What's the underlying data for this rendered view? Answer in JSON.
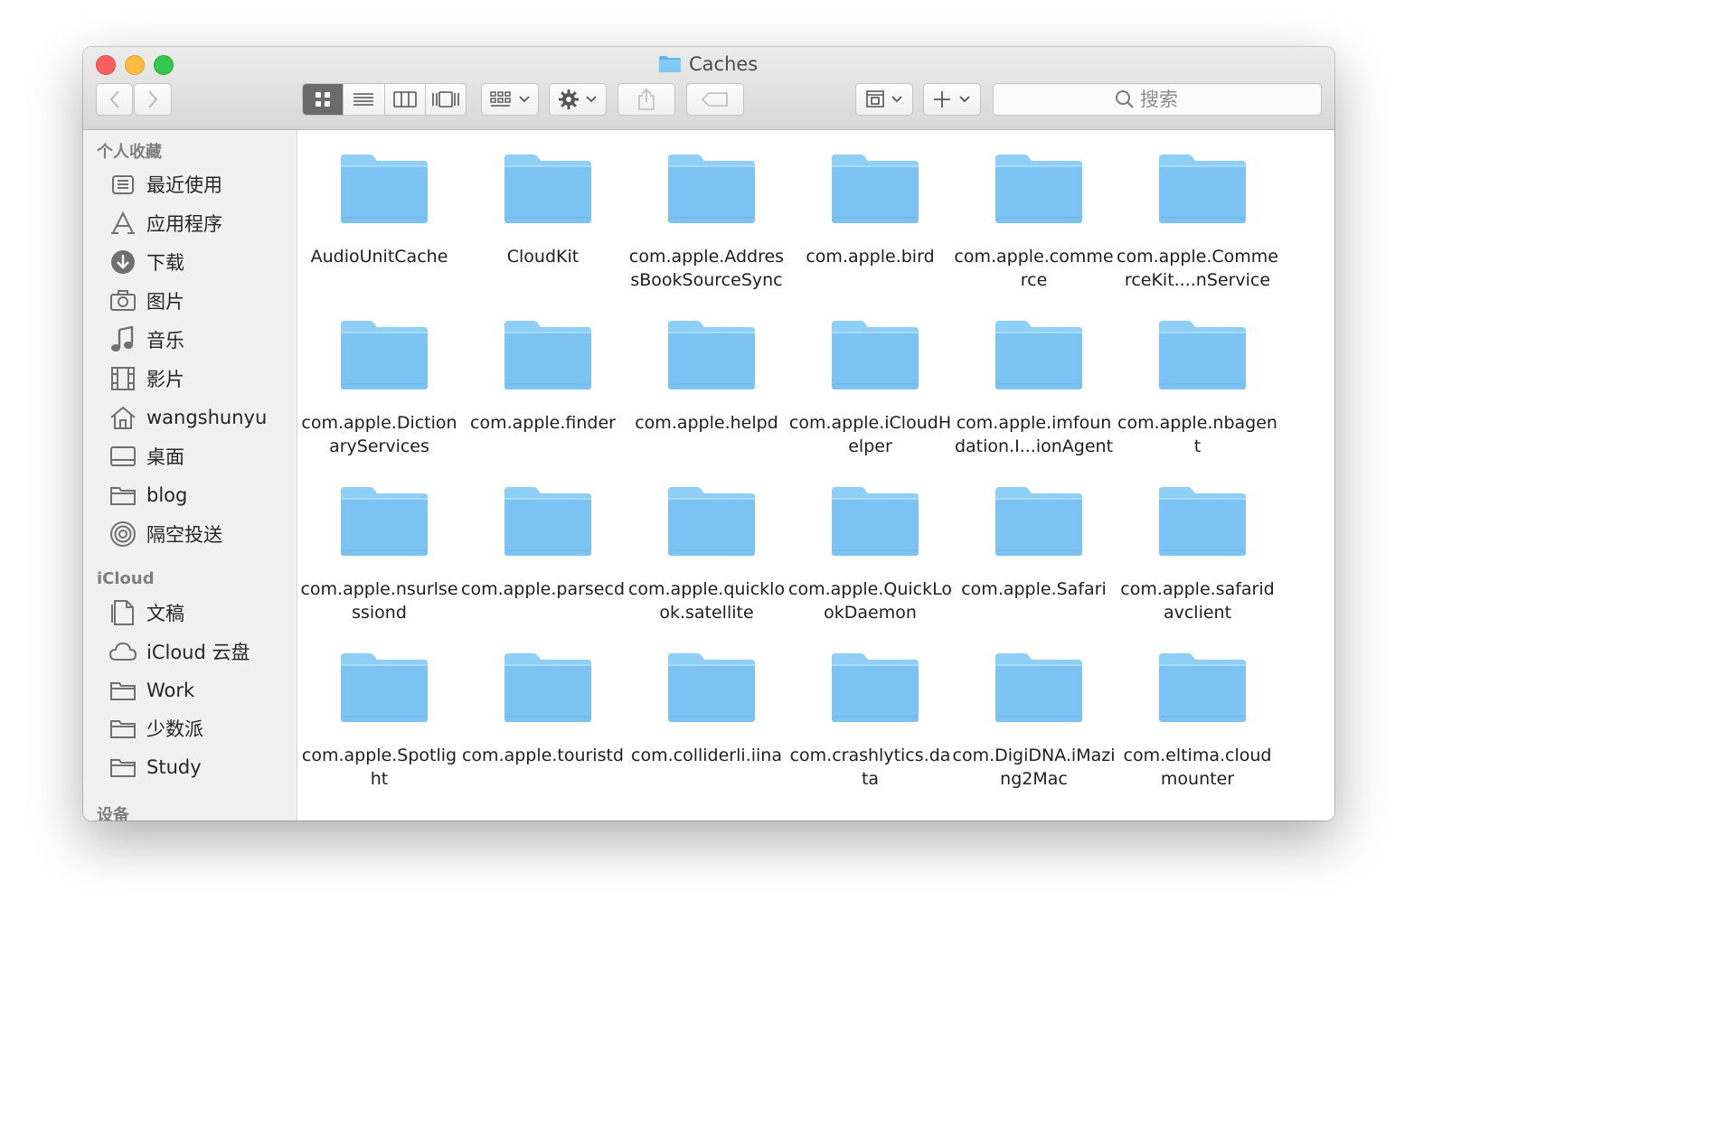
{
  "window": {
    "title": "Caches"
  },
  "toolbar": {
    "back_icon": "chevron-left-icon",
    "forward_icon": "chevron-right-icon",
    "view_modes": [
      "icon-view-icon",
      "list-view-icon",
      "column-view-icon",
      "gallery-view-icon"
    ],
    "active_view": "icon-view-icon",
    "search_placeholder": "搜索"
  },
  "sidebar": {
    "favorites_header": "个人收藏",
    "favorites": [
      {
        "label": "最近使用",
        "icon": "recents-icon"
      },
      {
        "label": "应用程序",
        "icon": "applications-icon"
      },
      {
        "label": "下载",
        "icon": "downloads-icon"
      },
      {
        "label": "图片",
        "icon": "camera-icon"
      },
      {
        "label": "音乐",
        "icon": "music-note-icon"
      },
      {
        "label": "影片",
        "icon": "film-icon"
      },
      {
        "label": "wangshunyu",
        "icon": "home-icon"
      },
      {
        "label": "桌面",
        "icon": "desktop-icon"
      },
      {
        "label": "blog",
        "icon": "folder-icon"
      },
      {
        "label": "隔空投送",
        "icon": "airdrop-icon"
      }
    ],
    "icloud_header": "iCloud",
    "icloud": [
      {
        "label": "文稿",
        "icon": "document-icon"
      },
      {
        "label": "iCloud 云盘",
        "icon": "cloud-icon"
      },
      {
        "label": "Work",
        "icon": "folder-icon"
      },
      {
        "label": "少数派",
        "icon": "folder-icon"
      },
      {
        "label": "Study",
        "icon": "folder-icon"
      }
    ],
    "devices_header": "设备"
  },
  "files": [
    "AudioUnitCache",
    "CloudKit",
    "com.apple.AddressBookSourceSync",
    "com.apple.bird",
    "com.apple.commerce",
    "com.apple.CommerceKit....nService",
    "com.apple.DictionaryServices",
    "com.apple.finder",
    "com.apple.helpd",
    "com.apple.iCloudHelper",
    "com.apple.imfoundation.I...ionAgent",
    "com.apple.nbagent",
    "com.apple.nsurlsessiond",
    "com.apple.parsecd",
    "com.apple.quicklook.satellite",
    "com.apple.QuickLookDaemon",
    "com.apple.Safari",
    "com.apple.safaridavclient",
    "com.apple.Spotlight",
    "com.apple.touristd",
    "com.colliderli.iina",
    "com.crashlytics.data",
    "com.DigiDNA.iMazing2Mac",
    "com.eltima.cloudmounter"
  ],
  "colors": {
    "folder": "#7cc3f3",
    "folder_tab": "#8fcff6",
    "accent_close": "#fc605c",
    "accent_min": "#fdbc40",
    "accent_max": "#34c84a"
  }
}
